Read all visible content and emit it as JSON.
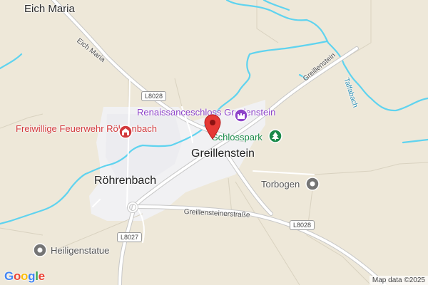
{
  "places": {
    "eich_maria": "Eich Maria",
    "greillenstein": "Greillenstein",
    "rohrenbach": "Röhrenbach"
  },
  "pois": {
    "schloss": "Renaissanceschloss Greillenstein",
    "schlosspark": "Schlosspark",
    "feuerwehr": "Freiwillige Feuerwehr Röhrenbach",
    "torbogen": "Torbogen",
    "heiligenstatue": "Heiligenstatue"
  },
  "roads": {
    "eich_maria_road": "Eich Maria",
    "greillenstein_road": "Greillenstein",
    "greillensteinerstrasse": "Greillensteinerstraße",
    "l8028_a": "L8028",
    "l8028_b": "L8028",
    "l8027": "L8027"
  },
  "waters": {
    "taffabach": "Taffabach"
  },
  "logo": "Google",
  "attribution": "Map data ©2025",
  "colors": {
    "land": "#eee8d9",
    "settlement": "#f1f1f3",
    "river": "#5fd3ef",
    "road": "#ffffff",
    "pin": "#e53935",
    "poi_purple": "#8e44c9",
    "poi_red": "#d2393c",
    "poi_green": "#1a8a4a",
    "poi_gray": "#757575"
  }
}
